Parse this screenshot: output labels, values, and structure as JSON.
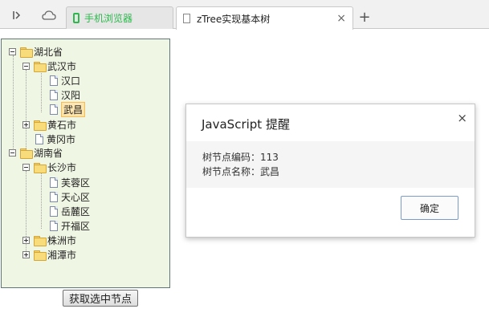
{
  "browser": {
    "tabs": [
      {
        "label": "手机浏览器",
        "icon": "phone-icon"
      },
      {
        "label": "zTree实现基本树",
        "icon": "page-icon"
      }
    ],
    "new_tab": "+",
    "close": "×"
  },
  "tree": {
    "nodes": [
      {
        "label": "湖北省"
      },
      {
        "label": "武汉市"
      },
      {
        "label": "汉口"
      },
      {
        "label": "汉阳"
      },
      {
        "label": "武昌"
      },
      {
        "label": "黄石市"
      },
      {
        "label": "黄冈市"
      },
      {
        "label": "湖南省"
      },
      {
        "label": "长沙市"
      },
      {
        "label": "芙蓉区"
      },
      {
        "label": "天心区"
      },
      {
        "label": "岳麓区"
      },
      {
        "label": "开福区"
      },
      {
        "label": "株洲市"
      },
      {
        "label": "湘潭市"
      }
    ]
  },
  "get_button": "获取选中节点",
  "dialog": {
    "title": "JavaScript 提醒",
    "close": "×",
    "line1": "树节点编码：113",
    "line2": "树节点名称：武昌",
    "ok": "确定"
  }
}
